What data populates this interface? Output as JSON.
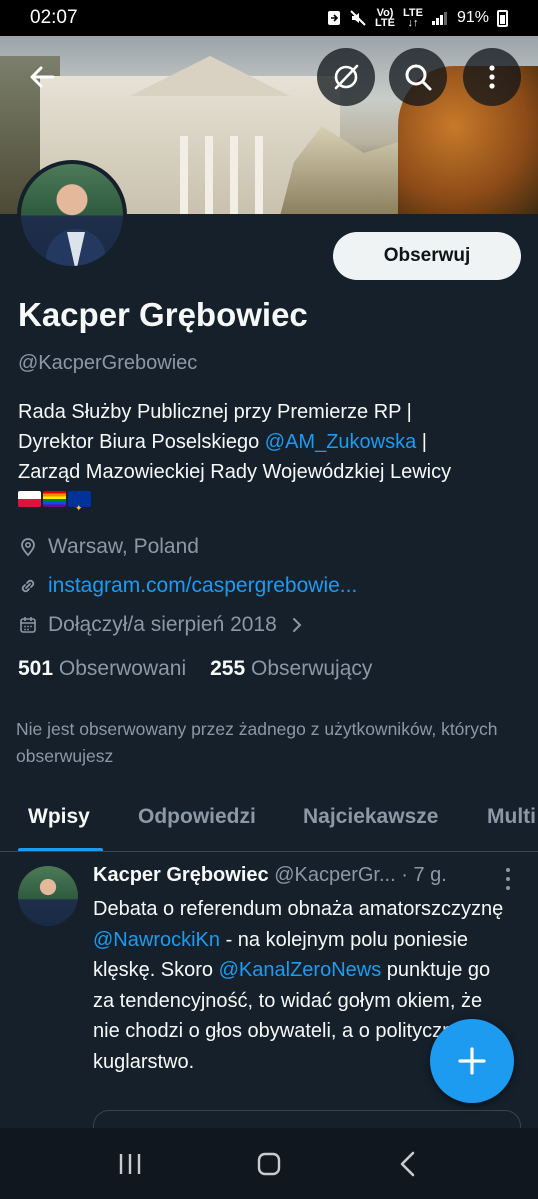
{
  "status_bar": {
    "time": "02:07",
    "network_top": "Vo)",
    "network_bottom": "LTE",
    "lte_top": "LTE",
    "lte_bottom": "↓↑",
    "battery": "91%",
    "icons": [
      "sync-icon",
      "mute-icon",
      "signal-icon",
      "battery-icon"
    ]
  },
  "header": {
    "icons": [
      "back-arrow-icon",
      "grok-icon",
      "search-icon",
      "more-vertical-icon"
    ]
  },
  "profile": {
    "follow_label": "Obserwuj",
    "name": "Kacper Grębowiec",
    "handle": "@KacperGrebowiec",
    "bio_line1": "Rada Służby Publicznej przy Premierze RP |",
    "bio_line2_pre": "Dyrektor Biura Poselskiego ",
    "bio_mention": "@AM_Zukowska",
    "bio_line2_post": " |",
    "bio_line3": "Zarząd Mazowieckiej Rady Wojewódzkiej Lewicy",
    "flags": [
      "flag-poland",
      "flag-rainbow",
      "flag-eu"
    ],
    "location": "Warsaw, Poland",
    "website": "instagram.com/caspergrebowie...",
    "joined": "Dołączył/a sierpień 2018",
    "following_count": "501",
    "following_label": "Obserwowani",
    "followers_count": "255",
    "followers_label": "Obserwujący",
    "not_followed_note": "Nie jest obserwowany przez żadnego z użytkowników, których obserwujesz"
  },
  "tabs": [
    {
      "label": "Wpisy",
      "active": true
    },
    {
      "label": "Odpowiedzi",
      "active": false
    },
    {
      "label": "Najciekawsze",
      "active": false
    },
    {
      "label": "Multi",
      "active": false
    }
  ],
  "tweet": {
    "author_name": "Kacper Grębowiec",
    "author_handle": "@KacperGr...",
    "separator": " · ",
    "time": "7 g.",
    "text_1": "Debata o referendum obnaża amatorszczyznę ",
    "mention_1": "@NawrockiKn",
    "text_2": " - na kolejnym polu poniesie klęskę. Skoro ",
    "mention_2": "@KanalZeroNews",
    "text_3": " punktuje go za tendencyjność, to widać gołym okiem, że nie chodzi o głos obywateli, a o polityczne kuglarstwo."
  },
  "colors": {
    "background": "#15202b",
    "accent": "#1d9bf0",
    "secondary_text": "#8b98a5"
  }
}
